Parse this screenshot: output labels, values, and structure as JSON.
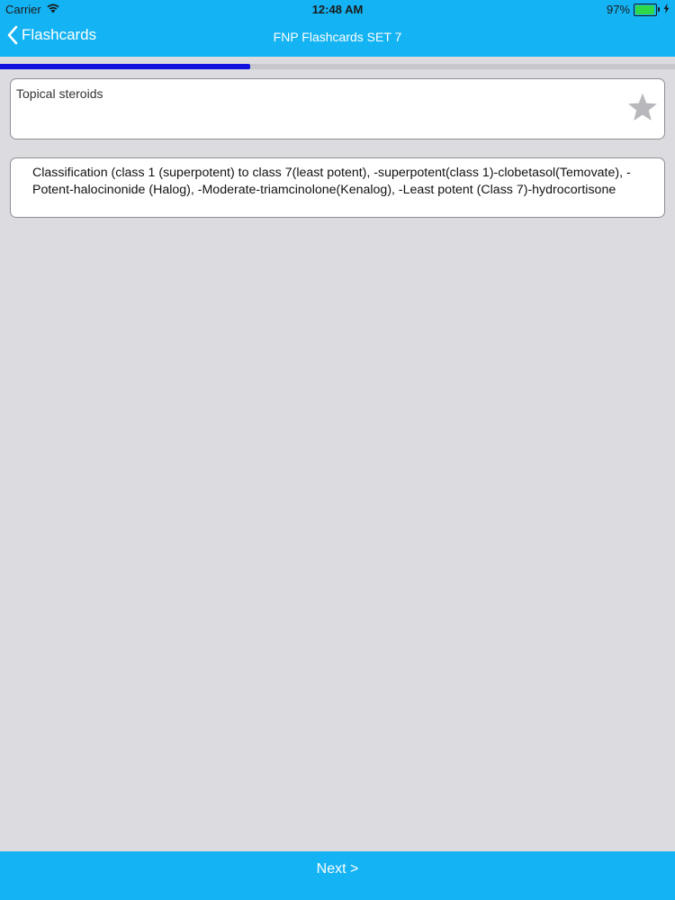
{
  "status_bar": {
    "carrier": "Carrier",
    "time": "12:48 AM",
    "battery": "97%",
    "battery_level": 0.97
  },
  "nav": {
    "back_label": "Flashcards",
    "title": "FNP Flashcards SET 7"
  },
  "progress": {
    "fraction": 0.37
  },
  "question": {
    "text": "Topical steroids"
  },
  "answer": {
    "text": "Classification (class 1 (superpotent) to class 7(least potent), -superpotent(class 1)-clobetasol(Temovate), -Potent-halocinonide (Halog), -Moderate-triamcinolone(Kenalog), -Least potent (Class 7)-hydrocortisone"
  },
  "footer": {
    "next_label": "Next >"
  },
  "colors": {
    "header": "#14b3f4",
    "progress": "#1212e0",
    "background": "#dcdce0",
    "star": "#b8b8bc"
  },
  "icons": {
    "wifi": "wifi-icon",
    "battery": "battery-icon",
    "charging": "charging-icon",
    "back": "chevron-left-icon",
    "favorite": "star-icon"
  }
}
